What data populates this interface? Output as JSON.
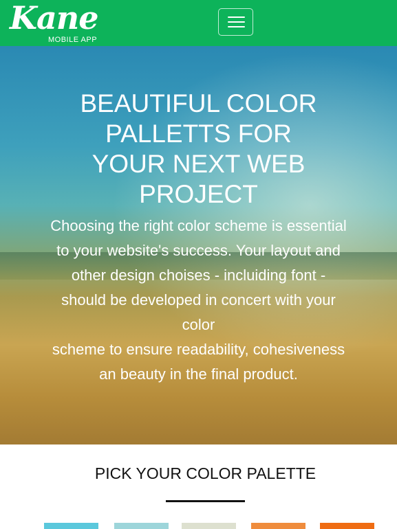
{
  "header": {
    "logo_text": "Kane",
    "logo_subtitle": "MOBILE APP",
    "background_color": "#0db35a"
  },
  "hero": {
    "title_line1": "BEAUTIFUL COLOR",
    "title_line2": "PALLETTS FOR",
    "title_line3": "YOUR NEXT WEB",
    "title_line4": "PROJECT",
    "text_line1": "Choosing the right color scheme is essential",
    "text_line2": "to your website's success. Your layout and",
    "text_line3": "other design choises - incluiding font -",
    "text_line4": "should be developed in concert with your",
    "text_line5": "color",
    "text_line6": "scheme to ensure readability, cohesiveness",
    "text_line7": "an beauty in the final product."
  },
  "palette_section": {
    "title": "PICK YOUR COLOR PALETTE",
    "swatches": [
      "#5bc8dc",
      "#9dd5da",
      "#dde0cf",
      "#ef8c3d",
      "#ef6c12"
    ]
  }
}
